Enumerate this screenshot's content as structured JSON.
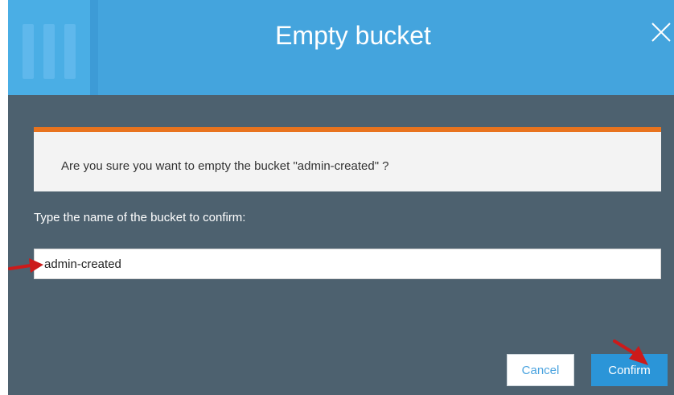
{
  "dialog": {
    "title": "Empty bucket",
    "warning_text": "Are you sure you want to empty the bucket \"admin-created\" ?",
    "confirm_label": "Type the name of the bucket to confirm:",
    "input_value": "admin-created",
    "cancel_label": "Cancel",
    "confirm_button_label": "Confirm"
  },
  "icons": {
    "close": "close-icon",
    "logo": "bars-logo-icon",
    "annotation_arrow": "arrow-annotation-icon"
  },
  "colors": {
    "header": "#44a4dd",
    "body": "#4d616f",
    "warning_accent": "#e8731e",
    "primary_button": "#2b95d8",
    "annotation": "#cc1a1a"
  }
}
